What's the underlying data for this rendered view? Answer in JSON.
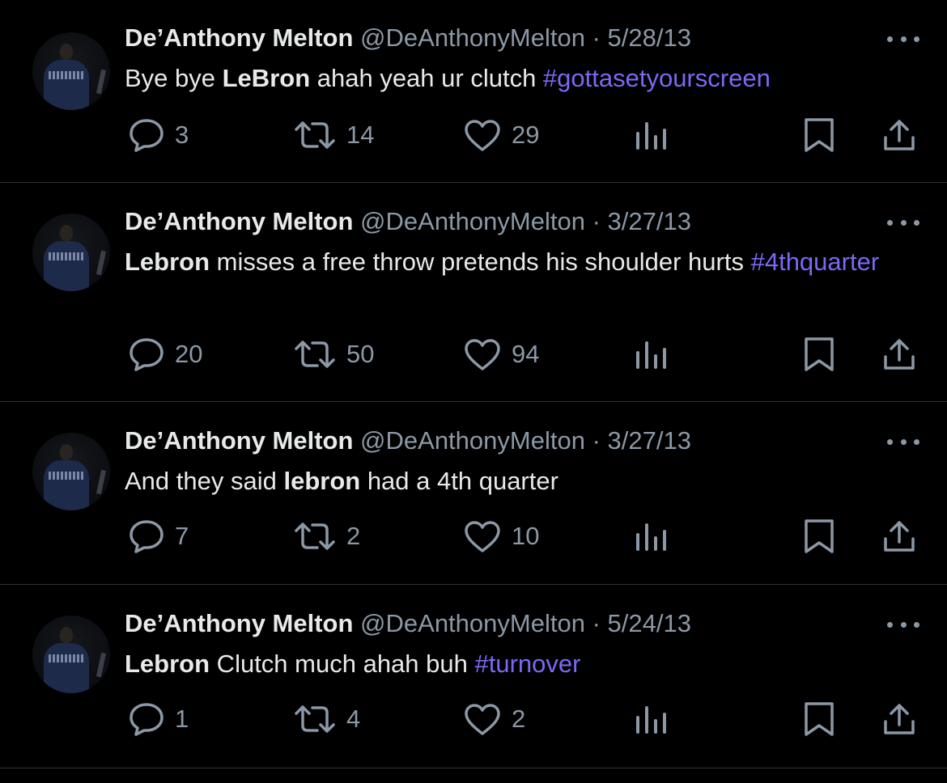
{
  "tweets": [
    {
      "name": "De’Anthony Melton",
      "handle": "@DeAnthonyMelton",
      "sep": "·",
      "date": "5/28/13",
      "text": [
        {
          "t": "Bye bye ",
          "s": "plain"
        },
        {
          "t": "LeBron",
          "s": "bold"
        },
        {
          "t": " ahah yeah ur clutch ",
          "s": "plain"
        },
        {
          "t": "#gottasetyourscreen",
          "s": "tag"
        }
      ],
      "replies": "3",
      "retweets": "14",
      "likes": "29"
    },
    {
      "name": "De’Anthony Melton",
      "handle": "@DeAnthonyMelton",
      "sep": "·",
      "date": "3/27/13",
      "text": [
        {
          "t": "Lebron",
          "s": "bold"
        },
        {
          "t": " misses a free throw pretends his shoulder hurts ",
          "s": "plain"
        },
        {
          "t": "#4thquarter",
          "s": "tag"
        }
      ],
      "replies": "20",
      "retweets": "50",
      "likes": "94"
    },
    {
      "name": "De’Anthony Melton",
      "handle": "@DeAnthonyMelton",
      "sep": "·",
      "date": "3/27/13",
      "text": [
        {
          "t": "And they said ",
          "s": "plain"
        },
        {
          "t": "lebron",
          "s": "bold"
        },
        {
          "t": " had a 4th quarter",
          "s": "plain"
        }
      ],
      "replies": "7",
      "retweets": "2",
      "likes": "10"
    },
    {
      "name": "De’Anthony Melton",
      "handle": "@DeAnthonyMelton",
      "sep": "·",
      "date": "5/24/13",
      "text": [
        {
          "t": "Lebron",
          "s": "bold"
        },
        {
          "t": " Clutch much ahah buh ",
          "s": "plain"
        },
        {
          "t": "#turnover",
          "s": "tag"
        }
      ],
      "replies": "1",
      "retweets": "4",
      "likes": "2"
    }
  ],
  "icons": {
    "reply": "reply-icon",
    "retweet": "retweet-icon",
    "like": "heart-icon",
    "views": "views-icon",
    "bookmark": "bookmark-icon",
    "share": "share-icon",
    "more": "more-icon"
  },
  "colors": {
    "background": "#000000",
    "text": "#e7e9ea",
    "muted": "#8b98a5",
    "hashtag": "#7b68f5",
    "divider": "#2f3336"
  }
}
